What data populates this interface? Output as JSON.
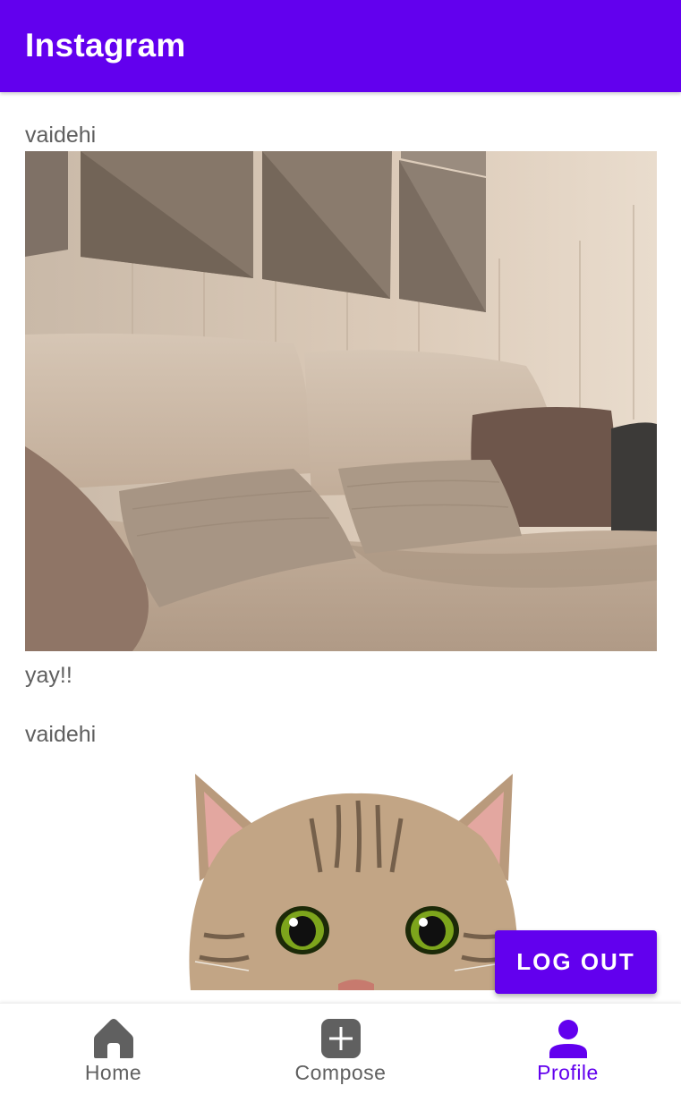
{
  "app": {
    "title": "Instagram"
  },
  "colors": {
    "primary": "#6200ee",
    "inactive": "#606060",
    "text": "#5f5f5f"
  },
  "feed": {
    "posts": [
      {
        "username": "vaidehi",
        "image": "sofa-photo",
        "caption": "yay!!"
      },
      {
        "username": "vaidehi",
        "image": "cat-photo",
        "caption": ""
      }
    ]
  },
  "actions": {
    "logout_label": "LOG OUT"
  },
  "bottom_nav": {
    "items": [
      {
        "label": "Home",
        "icon": "home-icon",
        "active": false
      },
      {
        "label": "Compose",
        "icon": "compose-icon",
        "active": false
      },
      {
        "label": "Profile",
        "icon": "profile-icon",
        "active": true
      }
    ]
  }
}
